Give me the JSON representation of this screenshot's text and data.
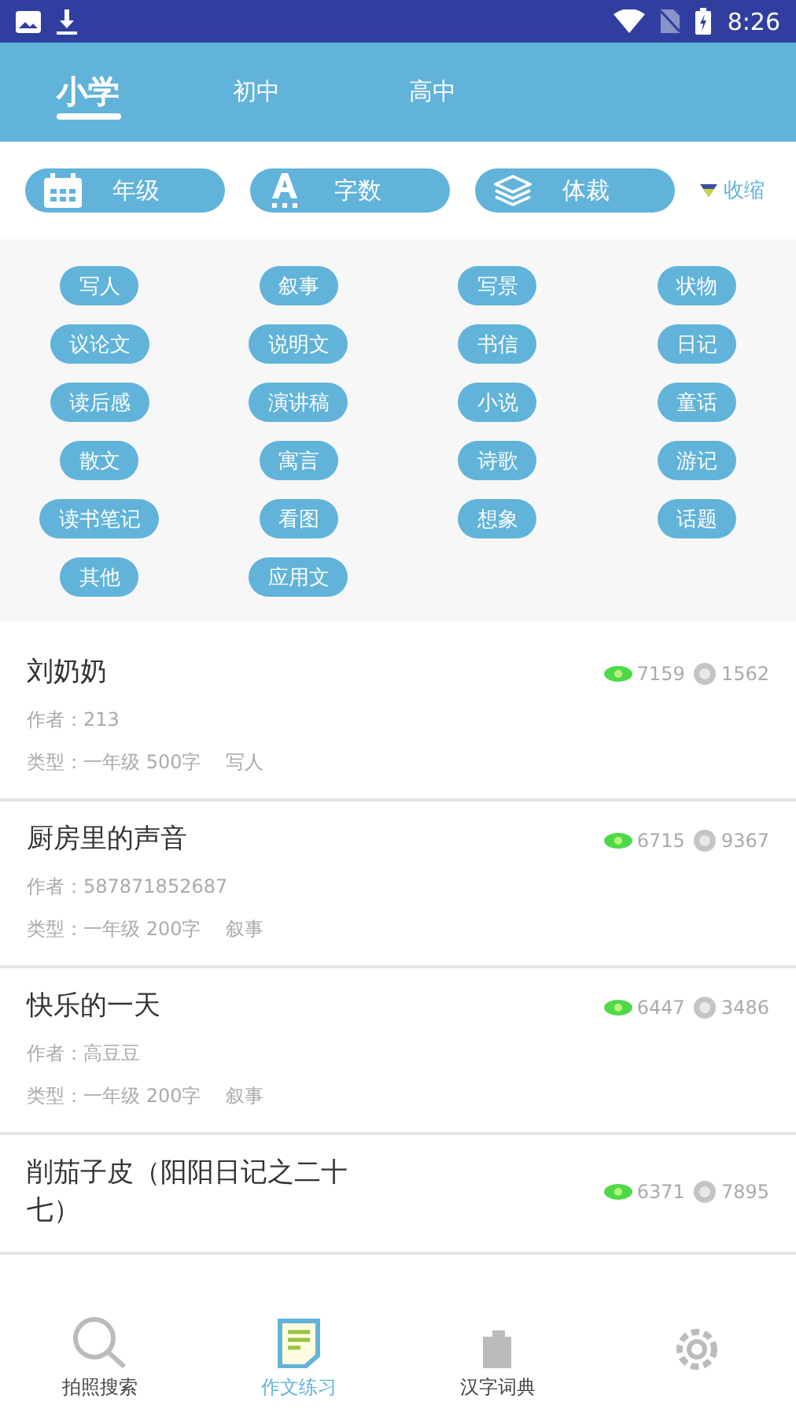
{
  "status_bar": {
    "time": "8:26"
  },
  "tabs": [
    {
      "label": "小学",
      "selected": true
    },
    {
      "label": "初中",
      "selected": false
    },
    {
      "label": "高中",
      "selected": false
    }
  ],
  "filters": [
    {
      "label": "年级"
    },
    {
      "label": "字数"
    },
    {
      "label": "体裁"
    }
  ],
  "collapse": {
    "label": "收缩"
  },
  "tags": [
    "写人",
    "叙事",
    "写景",
    "状物",
    "议论文",
    "说明文",
    "书信",
    "日记",
    "读后感",
    "演讲稿",
    "小说",
    "童话",
    "散文",
    "寓言",
    "诗歌",
    "游记",
    "读书笔记",
    "看图",
    "想象",
    "话题",
    "其他",
    "应用文"
  ],
  "articles": [
    {
      "title": "刘奶奶",
      "author": "作者：213",
      "type": "类型：一年级  500字",
      "genre": "写人",
      "views": "7159",
      "comments": "1562"
    },
    {
      "title": "厨房里的声音",
      "author": "作者：587871852687",
      "type": "类型：一年级  200字",
      "genre": "叙事",
      "views": "6715",
      "comments": "9367"
    },
    {
      "title": "快乐的一天",
      "author": "作者：高豆豆",
      "type": "类型：一年级  200字",
      "genre": "叙事",
      "views": "6447",
      "comments": "3486"
    },
    {
      "title": "削茄子皮（阳阳日记之二十七）",
      "views": "6371",
      "comments": "7895"
    }
  ],
  "nav": [
    {
      "label": "拍照搜索",
      "selected": false
    },
    {
      "label": "作文练习",
      "selected": true
    },
    {
      "label": "汉字词典",
      "selected": false
    },
    {
      "selected": false
    }
  ]
}
